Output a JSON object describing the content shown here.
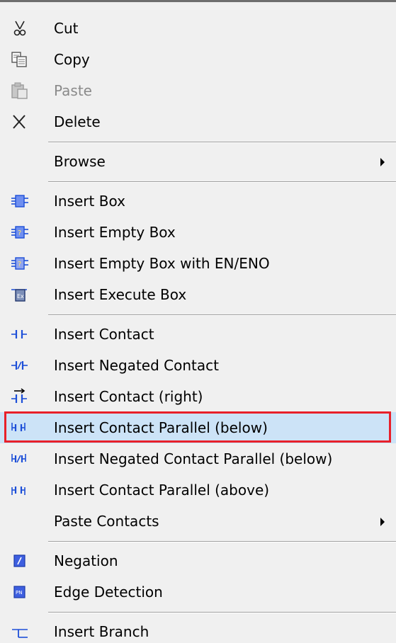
{
  "menu": {
    "items": [
      {
        "label": "Cut",
        "icon": "cut-icon",
        "enabled": true
      },
      {
        "label": "Copy",
        "icon": "copy-icon",
        "enabled": true
      },
      {
        "label": "Paste",
        "icon": "paste-icon",
        "enabled": false
      },
      {
        "label": "Delete",
        "icon": "delete-icon",
        "enabled": true
      },
      {
        "label": "Browse",
        "icon": "",
        "enabled": true,
        "submenu": true
      },
      {
        "label": "Insert Box",
        "icon": "insert-box-icon",
        "enabled": true
      },
      {
        "label": "Insert Empty Box",
        "icon": "insert-empty-box-icon",
        "enabled": true
      },
      {
        "label": "Insert Empty Box with EN/ENO",
        "icon": "insert-empty-box-en-eno-icon",
        "enabled": true
      },
      {
        "label": "Insert Execute Box",
        "icon": "insert-execute-box-icon",
        "enabled": true
      },
      {
        "label": "Insert Contact",
        "icon": "contact-icon",
        "enabled": true
      },
      {
        "label": "Insert Negated Contact",
        "icon": "negated-contact-icon",
        "enabled": true
      },
      {
        "label": "Insert Contact (right)",
        "icon": "contact-right-icon",
        "enabled": true
      },
      {
        "label": "Insert Contact Parallel (below)",
        "icon": "contact-parallel-below-icon",
        "enabled": true,
        "selected": true
      },
      {
        "label": "Insert Negated Contact Parallel (below)",
        "icon": "negated-contact-parallel-below-icon",
        "enabled": true
      },
      {
        "label": "Insert Contact Parallel (above)",
        "icon": "contact-parallel-above-icon",
        "enabled": true
      },
      {
        "label": "Paste Contacts",
        "icon": "",
        "enabled": true,
        "submenu": true
      },
      {
        "label": "Negation",
        "icon": "negation-icon",
        "enabled": true
      },
      {
        "label": "Edge Detection",
        "icon": "edge-detection-icon",
        "enabled": true
      },
      {
        "label": "Insert Branch",
        "icon": "insert-branch-icon",
        "enabled": true
      }
    ]
  },
  "colors": {
    "background": "#f0f0f0",
    "selection": "#cce3f7",
    "highlight_border": "#e8202a",
    "disabled_text": "#8a8a8a",
    "icon_blue": "#1d4fd8"
  }
}
